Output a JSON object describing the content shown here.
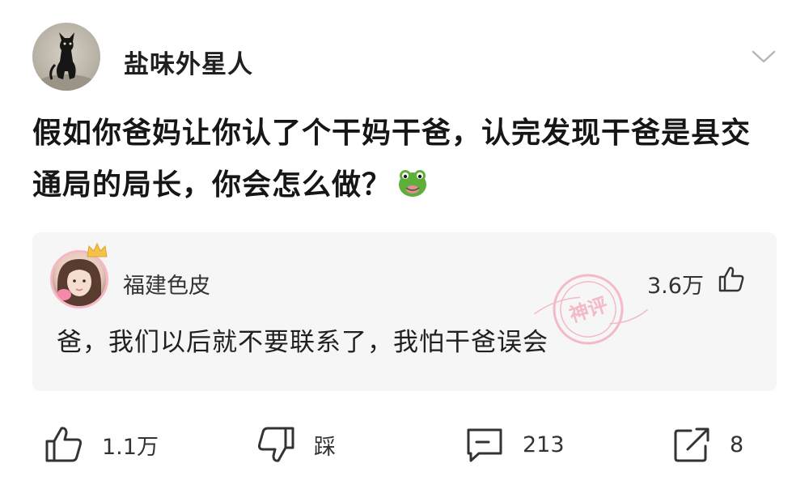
{
  "post": {
    "author_name": "盐味外星人",
    "text": "假如你爸妈让你认了个干妈干爸，认完发现干爸是县交通局的局长，你会怎么做？",
    "emoji": "green-frog-face-icon"
  },
  "hot_comment": {
    "user": "福建色皮",
    "likes": "3.6万",
    "text": "爸，我们以后就不要联系了，我怕干爸误会",
    "stamp_text": "神评"
  },
  "actions": {
    "like_count": "1.1万",
    "dislike_label": "踩",
    "comment_count": "213",
    "share_count": "8"
  },
  "colors": {
    "card_bg": "#f6f6f6",
    "stamp": "#f08aa0",
    "icon": "#333333"
  }
}
